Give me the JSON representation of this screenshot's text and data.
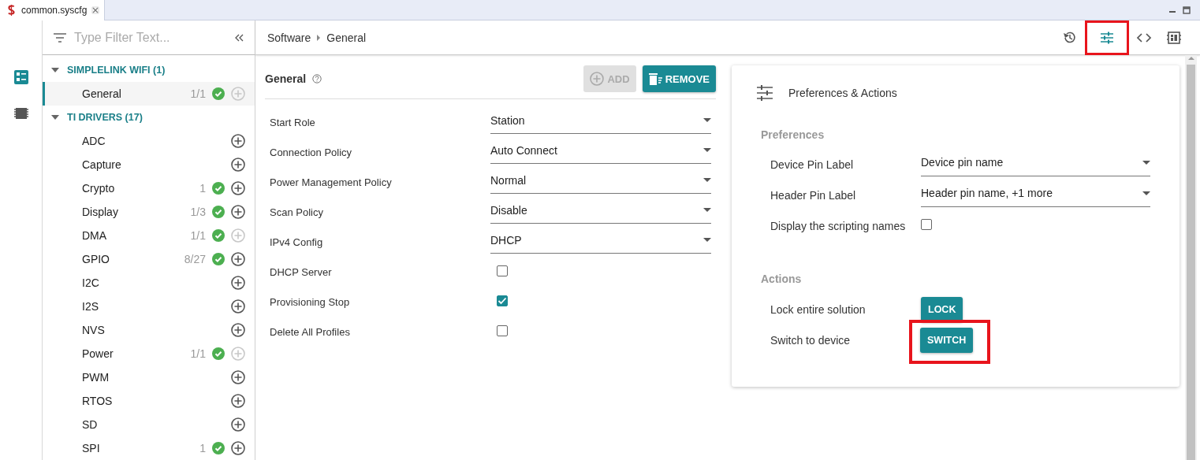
{
  "tab": {
    "title": "common.syscfg"
  },
  "rail": [
    {
      "kind": "modules",
      "selected": true
    },
    {
      "kind": "chip",
      "selected": false
    }
  ],
  "filter": {
    "placeholder": "Type Filter Text..."
  },
  "tree": [
    {
      "label": "SIMPLELINK WIFI (1)",
      "expanded": true,
      "children": [
        {
          "label": "General",
          "count": "1/1",
          "ok": true,
          "can_add": false,
          "selected": true
        }
      ]
    },
    {
      "label": "TI DRIVERS (17)",
      "expanded": true,
      "children": [
        {
          "label": "ADC",
          "ok": false,
          "can_add": true,
          "selected": false
        },
        {
          "label": "Capture",
          "ok": false,
          "can_add": true,
          "selected": false
        },
        {
          "label": "Crypto",
          "count": "1",
          "ok": true,
          "can_add": true,
          "selected": false
        },
        {
          "label": "Display",
          "count": "1/3",
          "ok": true,
          "can_add": true,
          "selected": false
        },
        {
          "label": "DMA",
          "count": "1/1",
          "ok": true,
          "can_add": false,
          "selected": false
        },
        {
          "label": "GPIO",
          "count": "8/27",
          "ok": true,
          "can_add": true,
          "selected": false
        },
        {
          "label": "I2C",
          "ok": false,
          "can_add": true,
          "selected": false
        },
        {
          "label": "I2S",
          "ok": false,
          "can_add": true,
          "selected": false
        },
        {
          "label": "NVS",
          "ok": false,
          "can_add": true,
          "selected": false
        },
        {
          "label": "Power",
          "count": "1/1",
          "ok": true,
          "can_add": false,
          "selected": false
        },
        {
          "label": "PWM",
          "ok": false,
          "can_add": true,
          "selected": false
        },
        {
          "label": "RTOS",
          "ok": false,
          "can_add": true,
          "selected": false
        },
        {
          "label": "SD",
          "ok": false,
          "can_add": true,
          "selected": false
        },
        {
          "label": "SPI",
          "count": "1",
          "ok": true,
          "can_add": true,
          "selected": false
        }
      ]
    }
  ],
  "breadcrumb": [
    "Software",
    "General"
  ],
  "toolbar": [
    {
      "kind": "history",
      "selected": false,
      "highlighted": false
    },
    {
      "kind": "preferences",
      "selected": true,
      "highlighted": true
    },
    {
      "kind": "code",
      "selected": false,
      "highlighted": false
    },
    {
      "kind": "board",
      "selected": false,
      "highlighted": false
    }
  ],
  "config": {
    "title": "General",
    "buttons": [
      {
        "kind": "add",
        "label": "ADD",
        "disabled": true
      },
      {
        "kind": "remove",
        "label": "REMOVE",
        "disabled": false
      }
    ],
    "rows": [
      {
        "kind": "select",
        "label": "Start Role",
        "value": "Station"
      },
      {
        "kind": "select",
        "label": "Connection Policy",
        "value": "Auto Connect"
      },
      {
        "kind": "select",
        "label": "Power Management Policy",
        "value": "Normal"
      },
      {
        "kind": "select",
        "label": "Scan Policy",
        "value": "Disable"
      },
      {
        "kind": "select",
        "label": "IPv4 Config",
        "value": "DHCP"
      },
      {
        "kind": "checkbox",
        "label": "DHCP Server",
        "checked": false
      },
      {
        "kind": "checkbox",
        "label": "Provisioning Stop",
        "checked": true
      },
      {
        "kind": "checkbox",
        "label": "Delete All Profiles",
        "checked": false
      }
    ]
  },
  "prefs": {
    "title": "Preferences & Actions",
    "preferences_heading": "Preferences",
    "preferences": [
      {
        "kind": "select",
        "label": "Device Pin Label",
        "value": "Device pin name"
      },
      {
        "kind": "select",
        "label": "Header Pin Label",
        "value": "Header pin name, +1 more"
      },
      {
        "kind": "checkbox",
        "label": "Display the scripting names",
        "checked": false
      }
    ],
    "actions_heading": "Actions",
    "actions": [
      {
        "label": "Lock entire solution",
        "button": "LOCK",
        "highlighted": false
      },
      {
        "label": "Switch to device",
        "button": "SWITCH",
        "highlighted": true
      }
    ]
  }
}
